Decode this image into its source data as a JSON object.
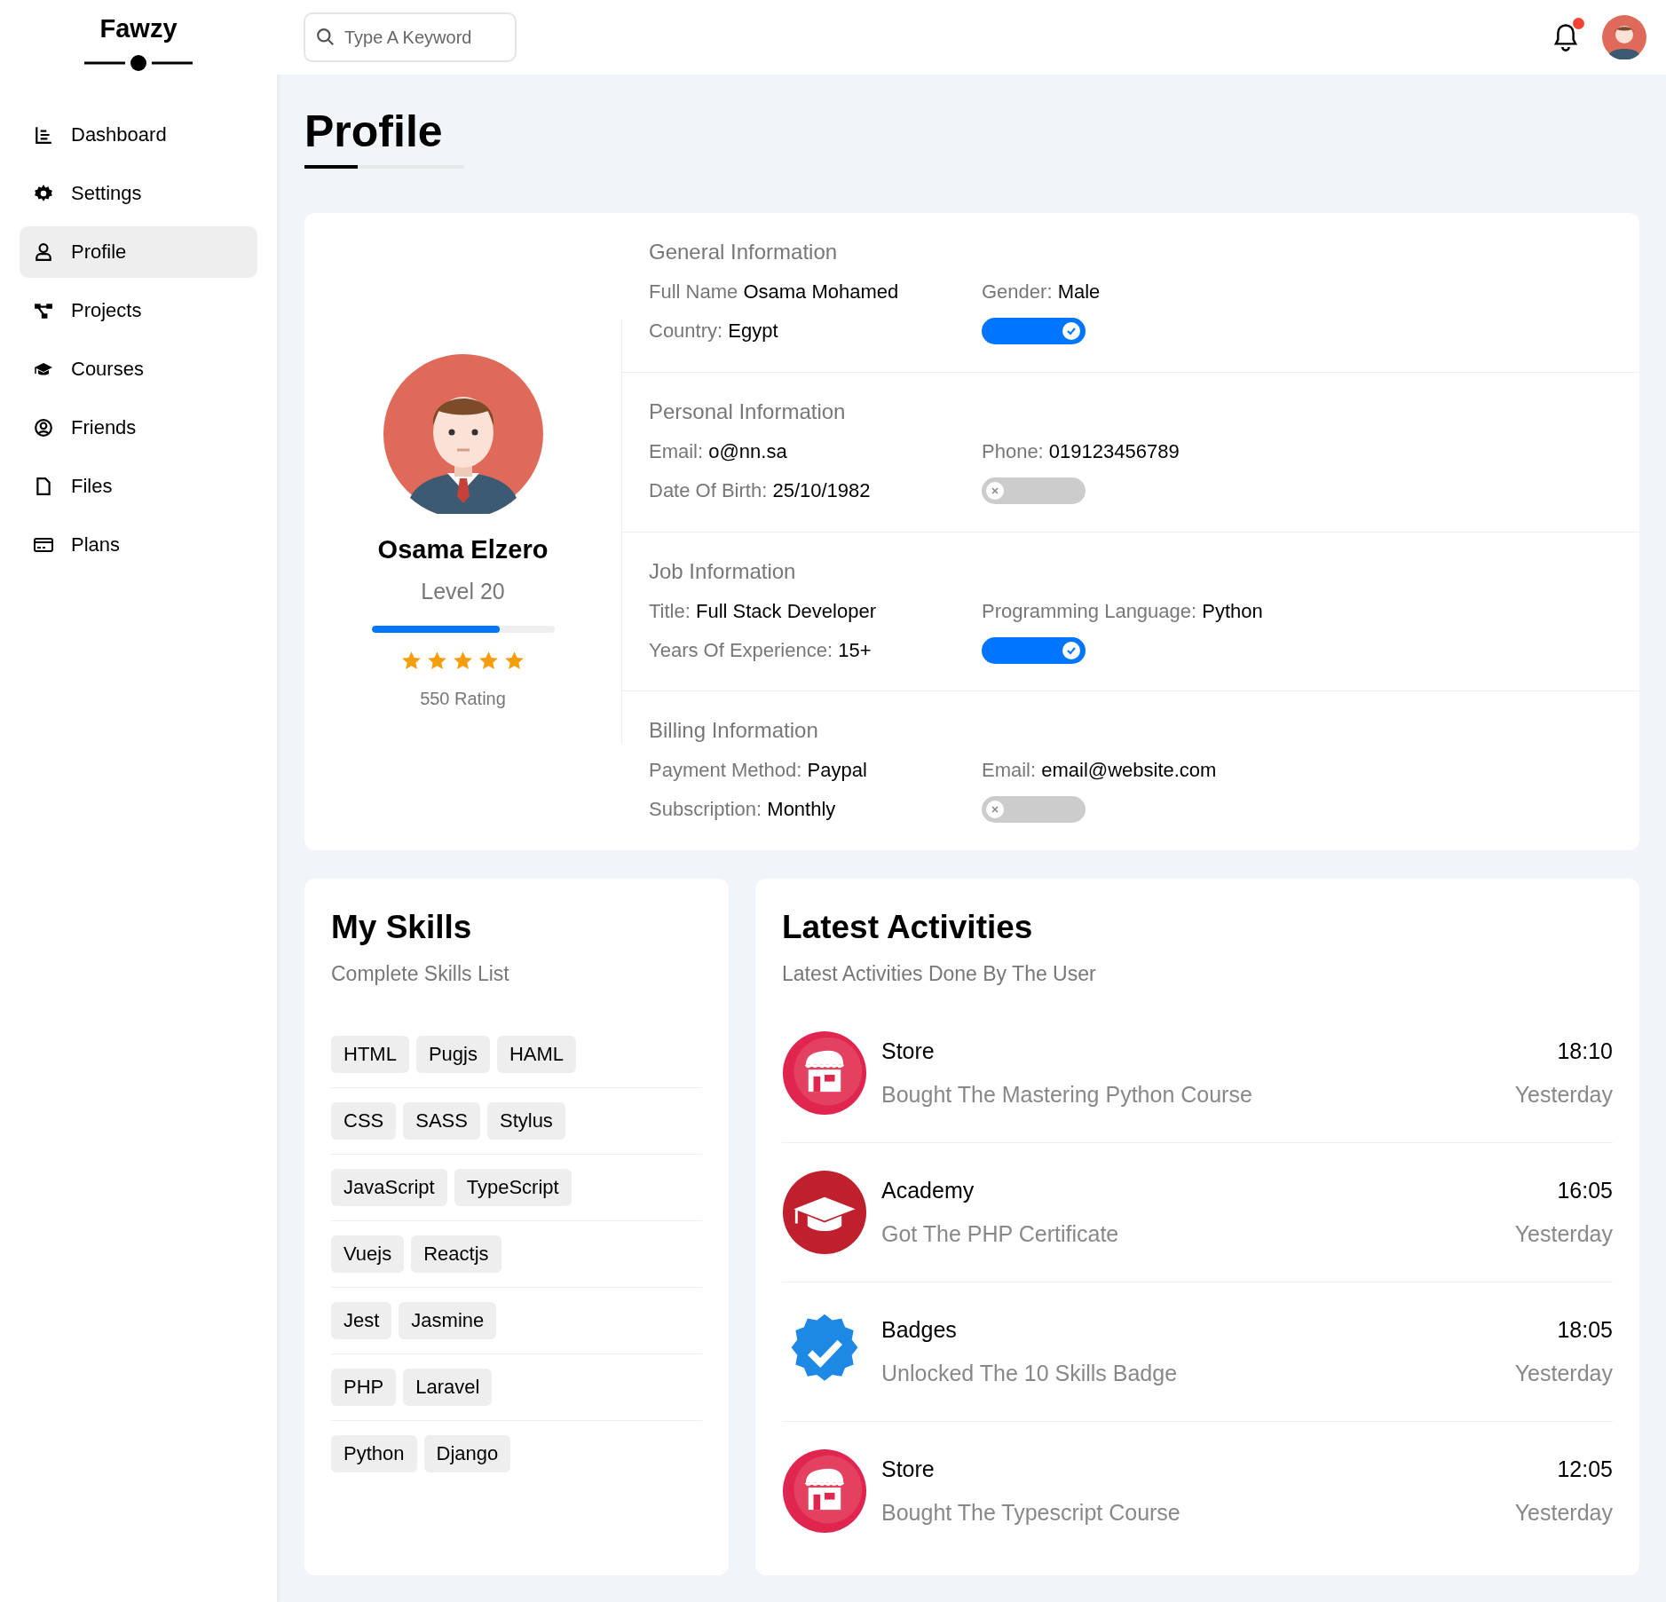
{
  "brand": {
    "name": "Fawzy"
  },
  "sidebar": {
    "items": [
      {
        "label": "Dashboard",
        "kind": "dashboard",
        "selected": false
      },
      {
        "label": "Settings",
        "kind": "settings",
        "selected": false
      },
      {
        "label": "Profile",
        "kind": "profile",
        "selected": true
      },
      {
        "label": "Projects",
        "kind": "projects",
        "selected": false
      },
      {
        "label": "Courses",
        "kind": "courses",
        "selected": false
      },
      {
        "label": "Friends",
        "kind": "friends",
        "selected": false
      },
      {
        "label": "Files",
        "kind": "files",
        "selected": false
      },
      {
        "label": "Plans",
        "kind": "plans",
        "selected": false
      }
    ]
  },
  "search": {
    "placeholder": "Type A Keyword"
  },
  "notifications": {
    "unread": true
  },
  "page_title": "Profile",
  "profile": {
    "name": "Osama Elzero",
    "level_label": "Level 20",
    "level": 0.7,
    "stars": 5,
    "rating": "550 Rating"
  },
  "info_sections": [
    {
      "title": "General Information",
      "fields": [
        {
          "label": "Full Name",
          "value": "Osama Mohamed"
        },
        {
          "label": "Gender:",
          "value": "Male"
        },
        {
          "label": "Country:",
          "value": "Egypt"
        }
      ],
      "on": true
    },
    {
      "title": "Personal Information",
      "fields": [
        {
          "label": "Email:",
          "value": "o@nn.sa"
        },
        {
          "label": "Phone:",
          "value": "019123456789"
        },
        {
          "label": "Date Of Birth:",
          "value": "25/10/1982"
        }
      ],
      "on": false
    },
    {
      "title": "Job Information",
      "fields": [
        {
          "label": "Title:",
          "value": "Full Stack Developer"
        },
        {
          "label": "Programming Language:",
          "value": "Python"
        },
        {
          "label": "Years Of Experience:",
          "value": "15+"
        }
      ],
      "on": true
    },
    {
      "title": "Billing Information",
      "fields": [
        {
          "label": "Payment Method:",
          "value": "Paypal"
        },
        {
          "label": "Email:",
          "value": "email@website.com"
        },
        {
          "label": "Subscription:",
          "value": "Monthly"
        }
      ],
      "on": false
    }
  ],
  "skills": {
    "title": "My Skills",
    "subtitle": "Complete Skills List",
    "rows": [
      [
        "HTML",
        "Pugjs",
        "HAML"
      ],
      [
        "CSS",
        "SASS",
        "Stylus"
      ],
      [
        "JavaScript",
        "TypeScript"
      ],
      [
        "Vuejs",
        "Reactjs"
      ],
      [
        "Jest",
        "Jasmine"
      ],
      [
        "PHP",
        "Laravel"
      ],
      [
        "Python",
        "Django"
      ]
    ]
  },
  "activities": {
    "title": "Latest Activities",
    "subtitle": "Latest Activities Done By The User",
    "items": [
      {
        "kind": "store",
        "title": "Store",
        "description": "Bought The Mastering Python Course",
        "time": "18:10",
        "day": "Yesterday"
      },
      {
        "kind": "academy",
        "title": "Academy",
        "description": "Got The PHP Certificate",
        "time": "16:05",
        "day": "Yesterday"
      },
      {
        "kind": "badge",
        "title": "Badges",
        "description": "Unlocked The 10 Skills Badge",
        "time": "18:05",
        "day": "Yesterday"
      },
      {
        "kind": "store",
        "title": "Store",
        "description": "Bought The Typescript Course",
        "time": "12:05",
        "day": "Yesterday"
      }
    ]
  }
}
